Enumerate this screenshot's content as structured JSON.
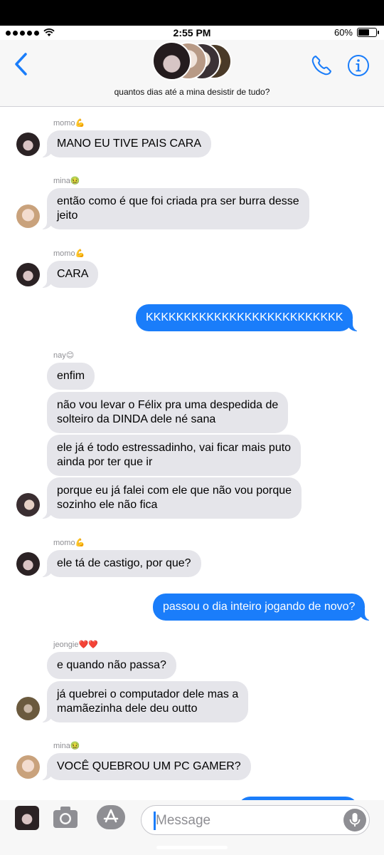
{
  "status": {
    "time": "2:55 PM",
    "battery": "60%",
    "battery_level": 0.6
  },
  "header": {
    "group_name": "quantos dias até a mina desistir de tudo?",
    "icons": [
      "back-chevron-icon",
      "phone-icon",
      "info-icon"
    ]
  },
  "messages": [
    {
      "sender": "momo💪",
      "text": "MANO EU TIVE PAIS CARA"
    },
    {
      "sender": "mina🤢",
      "text_1": "então como é que foi criada pra ser burra desse",
      "text_2": "jeito"
    },
    {
      "sender": "momo💪",
      "text": "CARA"
    },
    {
      "text": "KKKKKKKKKKKKKKKKKKKKKKKKKK"
    },
    {
      "sender": "nay😊",
      "text": "enfim"
    },
    {
      "text_1": "não vou levar o Félix pra uma despedida de",
      "text_2": "solteiro da DINDA dele né sana"
    },
    {
      "text_1": "ele já é todo estressadinho, vai ficar mais puto",
      "text_2": "ainda por ter que ir"
    },
    {
      "text_1": "porque eu já falei com ele que não vou porque",
      "text_2": "sozinho ele não fica"
    },
    {
      "sender": "momo💪",
      "text": "ele tá de castigo, por que?"
    },
    {
      "text": "passou o dia inteiro jogando de novo?"
    },
    {
      "sender": "jeongie❤️❤️",
      "text": "e quando não passa?"
    },
    {
      "text_1": "já quebrei o computador dele mas a",
      "text_2": "mamãezinha dele deu outto"
    },
    {
      "sender": "mina🤢",
      "text": "VOCÊ QUEBROU UM PC GAMER?"
    }
  ],
  "composer": {
    "placeholder": "Message"
  },
  "colors": {
    "accent": "#1a7dfa",
    "incoming": "#e5e5ea"
  }
}
